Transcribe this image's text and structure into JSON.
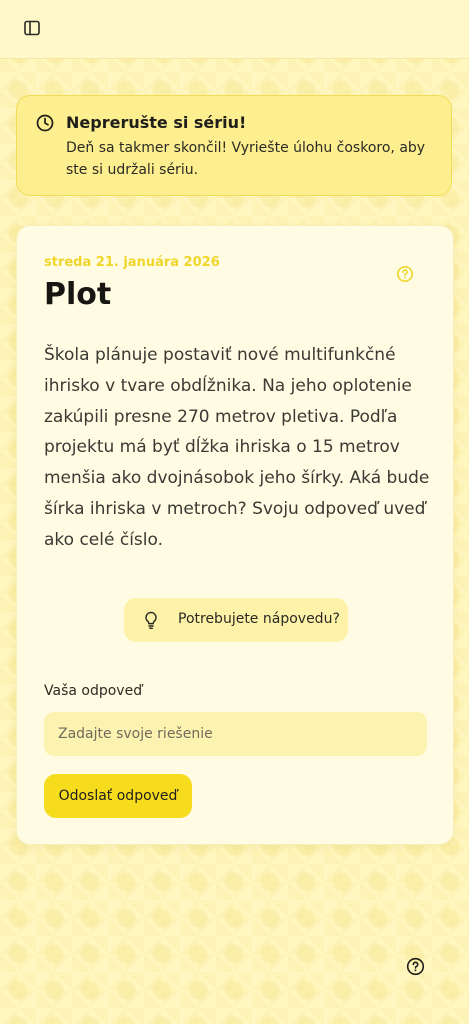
{
  "header": {
    "sidebar_toggle_icon": "sidebar-panel-icon"
  },
  "streak_banner": {
    "icon": "clock-icon",
    "title": "Neprerušte si sériu!",
    "message": "Deň sa takmer skončil! Vyriešte úlohu čoskoro, aby ste si udržali sériu."
  },
  "challenge": {
    "date": "streda 21. januára 2026",
    "title": "Plot",
    "help_icon": "question-circle-icon",
    "problem": "Škola plánuje postaviť nové multifunkčné ihrisko v tvare obdĺžnika. Na jeho oplotenie zakúpili presne 270 metrov pletiva. Podľa projektu má byť dĺžka ihriska o 15 metrov menšia ako dvojnásobok jeho šírky. Aká bude šírka ihriska v metroch? Svoju odpoveď uveď ako celé číslo.",
    "hint_icon": "lightbulb-icon",
    "hint_label": "Potrebujete nápovedu?"
  },
  "answer": {
    "label": "Vaša odpoveď",
    "placeholder": "Zadajte svoje riešenie",
    "value": "",
    "submit_label": "Odoslať odpoveď"
  },
  "floating_help": {
    "icon": "question-circle-icon"
  },
  "colors": {
    "background": "#fff7bf",
    "banner_background": "#fdee8f",
    "banner_border": "#f2dc55",
    "accent": "#f7dc1e",
    "date_color": "#f0d52a",
    "card_background": "#fffce3"
  }
}
